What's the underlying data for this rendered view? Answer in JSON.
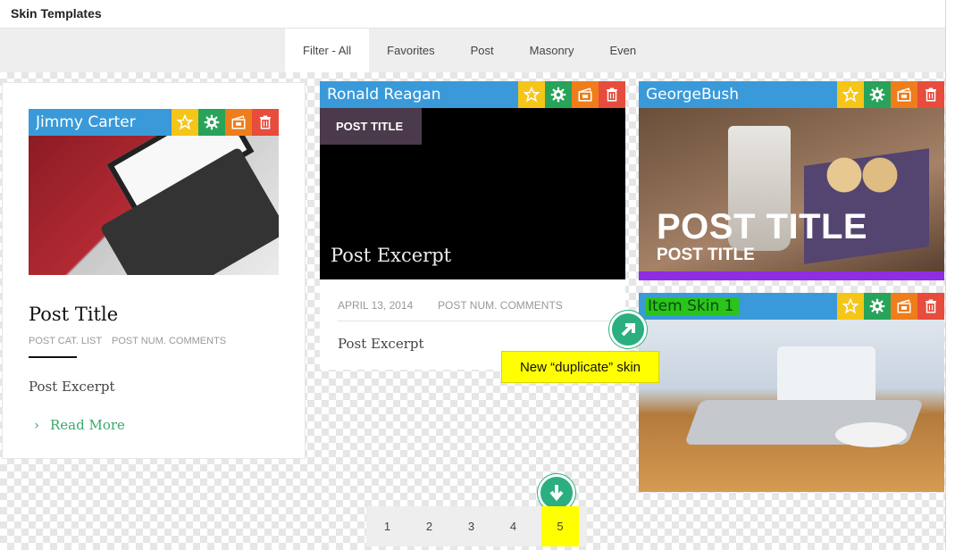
{
  "window": {
    "title": "Skin Templates"
  },
  "filter_tabs": [
    {
      "label": "Filter - All",
      "active": true
    },
    {
      "label": "Favorites"
    },
    {
      "label": "Post"
    },
    {
      "label": "Masonry"
    },
    {
      "label": "Even"
    }
  ],
  "cards": [
    {
      "name": "Jimmy Carter",
      "preview": {
        "title": "Post Title",
        "meta": [
          "POST CAT. LIST",
          "POST NUM. COMMENTS"
        ],
        "excerpt": "Post Excerpt",
        "read_more": "Read More"
      }
    },
    {
      "name": "Ronald Reagan",
      "preview": {
        "badge": "POST TITLE",
        "overlay_excerpt": "Post Excerpt",
        "date": "APRIL 13, 2014",
        "comments": "POST NUM. COMMENTS",
        "excerpt": "Post Excerpt"
      }
    },
    {
      "name": "GeorgeBush",
      "preview": {
        "title_big": "POST TITLE",
        "title_small": "POST TITLE"
      }
    },
    {
      "name": "Item Skin 1",
      "highlighted": true
    }
  ],
  "actions": [
    "star-icon",
    "gear-icon",
    "film-icon",
    "trash-icon"
  ],
  "colors": {
    "header_blue": "#3a9ad9",
    "star": "#f5c518",
    "gear": "#27a35a",
    "film": "#ef7d1b",
    "trash": "#e74c3c",
    "accent_green": "#2baf7f",
    "highlight_yellow": "#ffff00"
  },
  "annotation": {
    "tooltip": "New “duplicate” skin"
  },
  "pagination": {
    "pages": [
      "1",
      "2",
      "3",
      "4",
      "5"
    ],
    "current": "5"
  }
}
